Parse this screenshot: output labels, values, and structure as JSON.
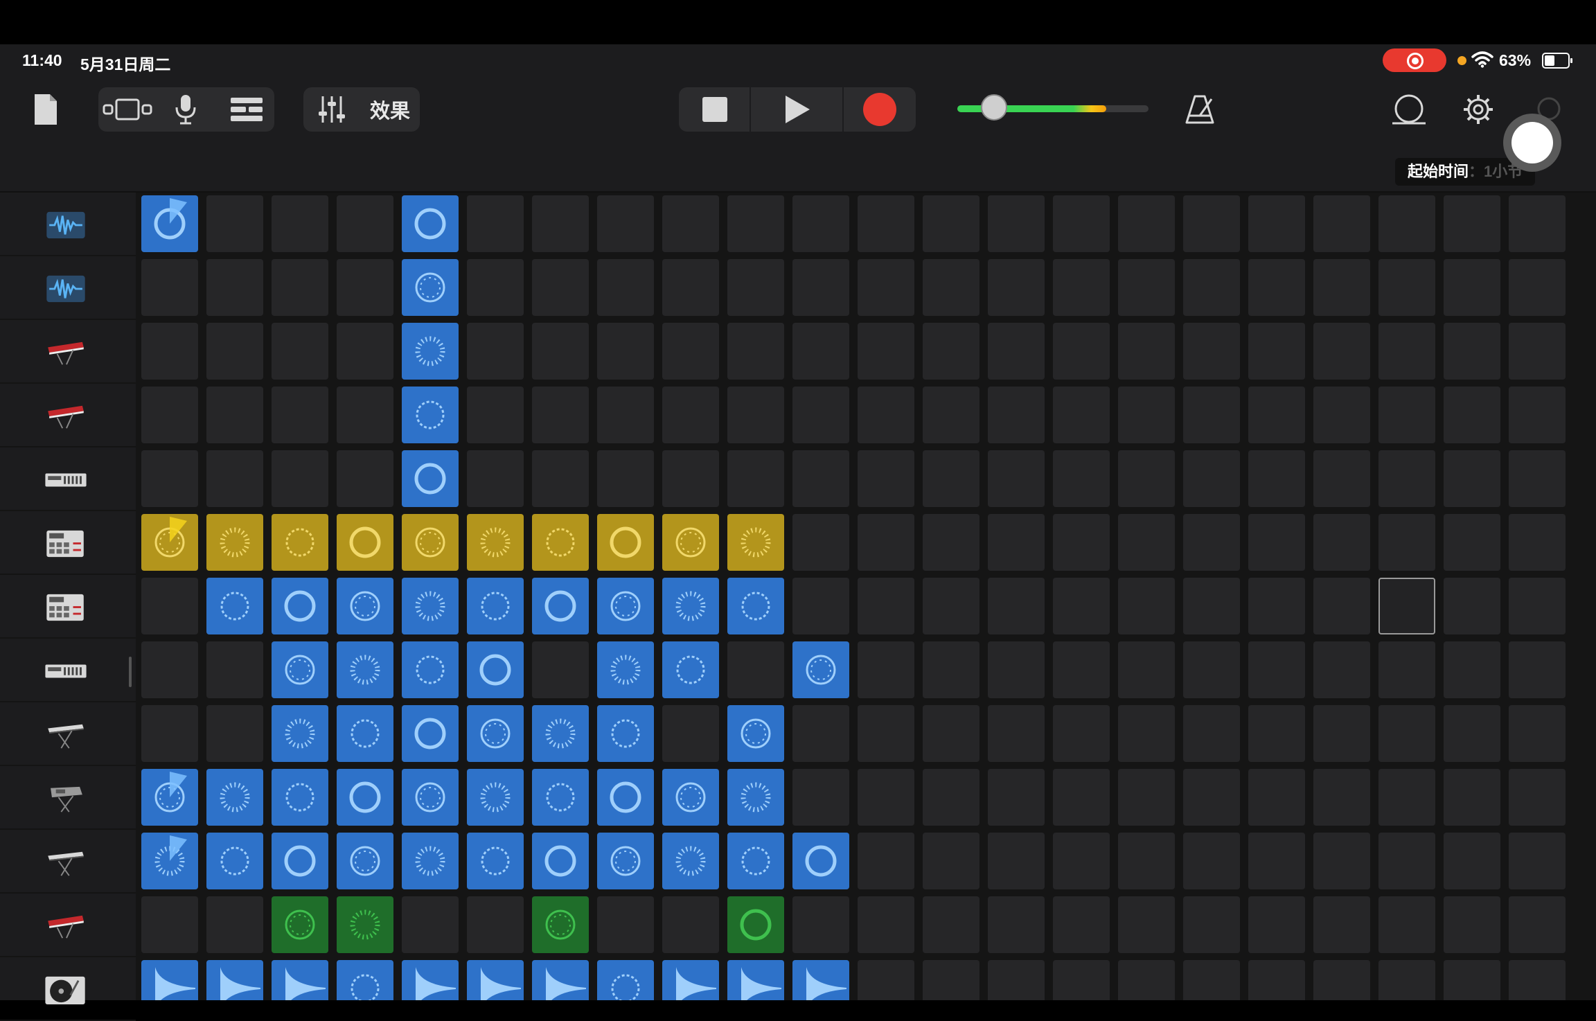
{
  "status_bar": {
    "time": "11:40",
    "date": "5月31日周二",
    "battery_percent": "63%",
    "recording_indicator": "screen-recording",
    "battery_level": 0.63
  },
  "toolbar": {
    "effects_label": "效果",
    "tooltip_label": "起始时间",
    "tooltip_rest": "：1小节",
    "master_volume": 0.78
  },
  "colors": {
    "blue": "#2e72c9",
    "yellow": "#b3951c",
    "green": "#1f6e2a",
    "record": "#e8392f"
  },
  "tracks": [
    {
      "icon": "audio-waveform-icon"
    },
    {
      "icon": "audio-waveform-icon"
    },
    {
      "icon": "red-keyboard-icon"
    },
    {
      "icon": "red-keyboard-icon"
    },
    {
      "icon": "synth-module-icon"
    },
    {
      "icon": "drum-machine-icon"
    },
    {
      "icon": "drum-machine-icon"
    },
    {
      "icon": "synth-module-icon"
    },
    {
      "icon": "keyboard-stand-icon"
    },
    {
      "icon": "synth-stand-icon"
    },
    {
      "icon": "keyboard-stand-icon"
    },
    {
      "icon": "red-keyboard-icon"
    },
    {
      "icon": "turntable-icon"
    }
  ],
  "grid": {
    "columns": 22,
    "rows": [
      "B...B.................",
      "....B.................",
      "....B.................",
      "....B.................",
      "....B.................",
      "YYYYYYYYYY............",
      ".BBBBBBBBB............",
      "..BBBB.BB.B...........",
      "..BBBBBB.B............",
      "BBBBBBBBBB............",
      "BBBBBBBBBBB...........",
      "..GG..G..G............",
      "BBBBBBBBBBB..........."
    ],
    "selected_cell": {
      "row": 6,
      "col": 19
    },
    "playing_cells": [
      {
        "row": 0,
        "col": 0
      },
      {
        "row": 5,
        "col": 0
      },
      {
        "row": 9,
        "col": 0
      },
      {
        "row": 10,
        "col": 0
      }
    ]
  }
}
